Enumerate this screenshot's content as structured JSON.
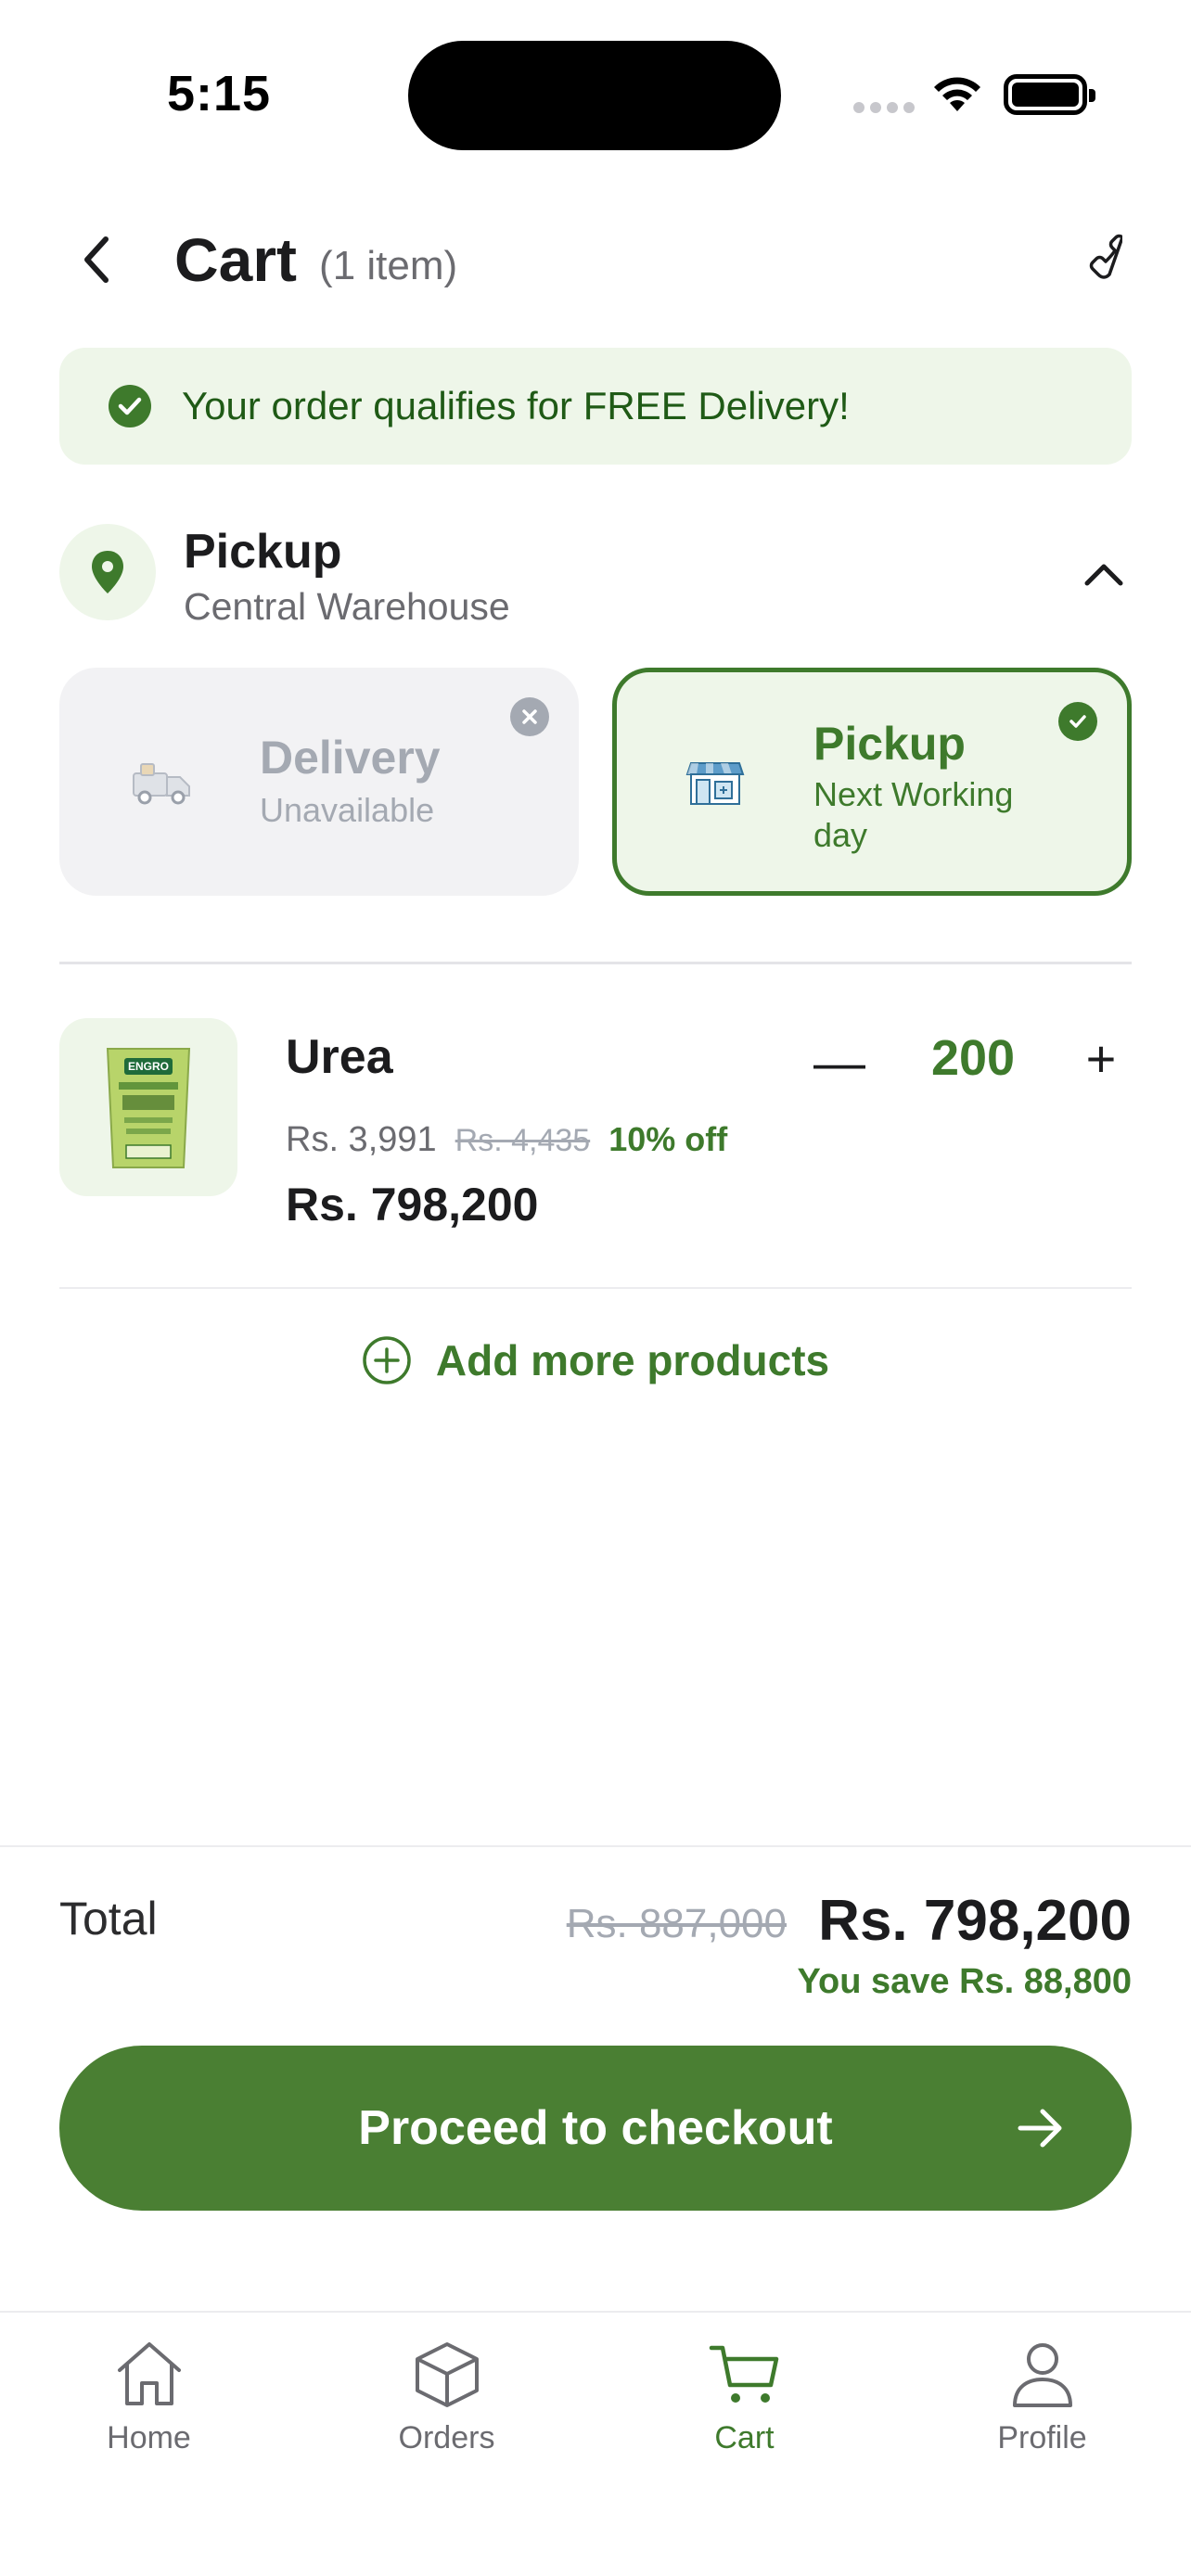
{
  "status_bar": {
    "time": "5:15"
  },
  "header": {
    "title": "Cart",
    "item_count": "(1 item)"
  },
  "banner": {
    "text": "Your order qualifies for FREE Delivery!"
  },
  "location": {
    "mode": "Pickup",
    "place": "Central Warehouse"
  },
  "options": {
    "delivery": {
      "title": "Delivery",
      "subtitle": "Unavailable",
      "state": "unavailable"
    },
    "pickup": {
      "title": "Pickup",
      "subtitle": "Next Working day",
      "state": "selected"
    }
  },
  "product": {
    "name": "Urea",
    "quantity": "200",
    "unit_price": "Rs. 3,991",
    "original_price": "Rs. 4,435",
    "discount": "10% off",
    "line_total": "Rs. 798,200",
    "minus_label": "—",
    "plus_label": "+"
  },
  "add_more": {
    "label": "Add more products"
  },
  "totals": {
    "label": "Total",
    "original": "Rs. 887,000",
    "total": "Rs. 798,200",
    "savings": "You save Rs. 88,800"
  },
  "checkout": {
    "label": "Proceed to checkout"
  },
  "tabbar": {
    "items": [
      {
        "label": "Home",
        "icon": "home-icon",
        "active": false
      },
      {
        "label": "Orders",
        "icon": "box-icon",
        "active": false
      },
      {
        "label": "Cart",
        "icon": "cart-icon",
        "active": true
      },
      {
        "label": "Profile",
        "icon": "profile-icon",
        "active": false
      }
    ]
  },
  "colors": {
    "brand_green": "#3e7a2c",
    "checkout_green": "#4a7f33",
    "banner_bg": "#eef6e9",
    "muted_gray": "#a4a9b2"
  }
}
